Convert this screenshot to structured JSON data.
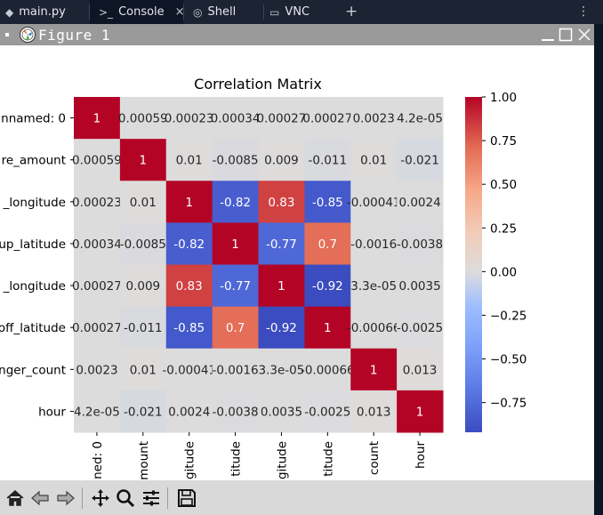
{
  "tabs": [
    {
      "label": "main.py",
      "icon": "python-file-icon"
    },
    {
      "label": "Console",
      "icon": "console-icon",
      "close": "×"
    },
    {
      "label": "Shell",
      "icon": "shell-icon"
    },
    {
      "label": "VNC",
      "icon": "monitor-icon"
    }
  ],
  "tab_add": "+",
  "tab_menu": "⋮",
  "window": {
    "title": "Figure 1"
  },
  "toolbar": {
    "tools": [
      "home-icon",
      "back-arrow-icon",
      "forward-arrow-icon",
      "pan-move-icon",
      "zoom-magnifier-icon",
      "configure-subplots-icon",
      "save-icon"
    ]
  },
  "chart_data": {
    "type": "heatmap",
    "title": "Correlation Matrix",
    "row_labels": [
      "nnamed: 0",
      "re_amount",
      "_longitude",
      "up_latitude",
      "_longitude",
      "off_latitude",
      "nger_count",
      "hour"
    ],
    "col_labels": [
      "ned: 0",
      "mount",
      "gitude",
      "titude",
      "gitude",
      "titude",
      "count",
      "hour"
    ],
    "values": [
      [
        1,
        0.00059,
        0.00023,
        0.00034,
        0.00027,
        0.00027,
        0.0023,
        4.2e-05
      ],
      [
        0.00059,
        1,
        0.01,
        -0.0085,
        0.009,
        -0.011,
        0.01,
        -0.021
      ],
      [
        0.00023,
        0.01,
        1,
        -0.82,
        0.83,
        -0.85,
        -0.00041,
        0.0024
      ],
      [
        0.00034,
        -0.0085,
        -0.82,
        1,
        -0.77,
        0.7,
        -0.0016,
        -0.0038
      ],
      [
        0.00027,
        0.009,
        0.83,
        -0.77,
        1,
        -0.92,
        3.3e-05,
        0.0035
      ],
      [
        0.00027,
        -0.011,
        -0.85,
        0.7,
        -0.92,
        1,
        -0.00066,
        -0.0025
      ],
      [
        0.0023,
        0.01,
        -0.00041,
        -0.0016,
        3.3e-05,
        -0.00066,
        1,
        0.013
      ],
      [
        4.2e-05,
        -0.021,
        0.0024,
        -0.0038,
        0.0035,
        -0.0025,
        0.013,
        1
      ]
    ],
    "annotations": [
      [
        "1",
        "0.00059",
        "0.00023",
        "0.00034",
        "0.00027",
        "0.00027",
        "0.0023",
        "4.2e-05"
      ],
      [
        "0.00059",
        "1",
        "0.01",
        "-0.0085",
        "0.009",
        "-0.011",
        "0.01",
        "-0.021"
      ],
      [
        "0.00023",
        "0.01",
        "1",
        "-0.82",
        "0.83",
        "-0.85",
        "-0.00041",
        "0.0024"
      ],
      [
        "0.00034",
        "-0.0085",
        "-0.82",
        "1",
        "-0.77",
        "0.7",
        "-0.0016",
        "-0.0038"
      ],
      [
        "0.00027",
        "0.009",
        "0.83",
        "-0.77",
        "1",
        "-0.92",
        "3.3e-05",
        "0.0035"
      ],
      [
        "0.00027",
        "-0.011",
        "-0.85",
        "0.7",
        "-0.92",
        "1",
        "-0.00066",
        "-0.0025"
      ],
      [
        "0.0023",
        "0.01",
        "-0.00041",
        "-0.0016",
        "3.3e-05",
        "-0.00066",
        "1",
        "0.013"
      ],
      [
        "4.2e-05",
        "-0.021",
        "0.0024",
        "-0.0038",
        "0.0035",
        "-0.0025",
        "0.013",
        "1"
      ]
    ],
    "row_tick_labels": [
      "nnamed: 0",
      "re_amount",
      "_longitude",
      "up_latitude",
      "_longitude",
      "off_latitude",
      "nger_count",
      "hour"
    ],
    "colorbar": {
      "range": [
        -0.92,
        1.0
      ],
      "ticks": [
        1.0,
        0.75,
        0.5,
        0.25,
        0.0,
        -0.25,
        -0.5,
        -0.75
      ],
      "tick_labels": [
        "1.00",
        "0.75",
        "0.50",
        "0.25",
        "0.00",
        "−0.25",
        "−0.50",
        "−0.75"
      ],
      "colormap": "coolwarm"
    }
  },
  "colors": {
    "ide_bg": "#1c2333",
    "titlebar": "#9a9a9a",
    "toolbar": "#d9d9d9"
  }
}
